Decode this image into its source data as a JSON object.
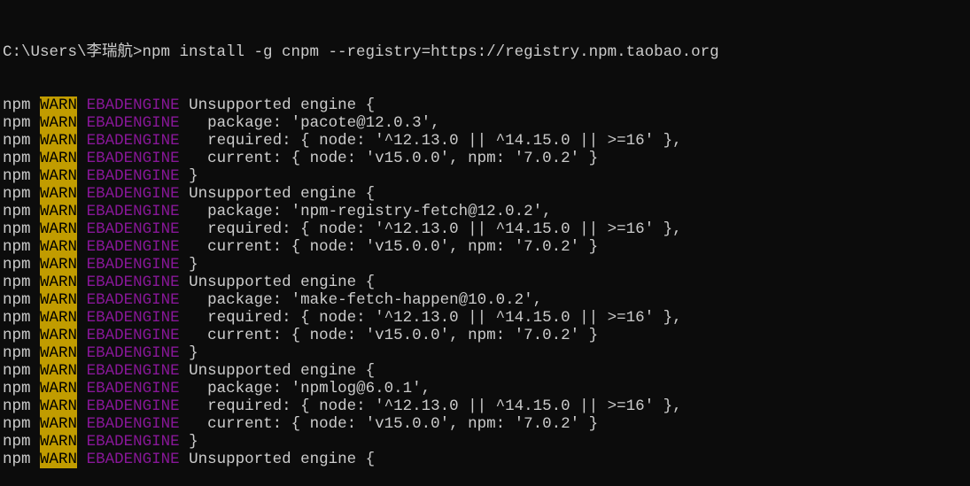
{
  "terminal": {
    "colors": {
      "background": "#0c0c0c",
      "foreground": "#cccccc",
      "warn_background": "#c19c00",
      "error_code": "#881798"
    },
    "prompt_line": "C:\\Users\\李瑞航>npm install -g cnpm --registry=https://registry.npm.taobao.org",
    "lines": [
      {
        "npm": "npm",
        "warn": "WARN",
        "code": "EBADENGINE",
        "message": " Unsupported engine {"
      },
      {
        "npm": "npm",
        "warn": "WARN",
        "code": "EBADENGINE",
        "message": "   package: 'pacote@12.0.3',"
      },
      {
        "npm": "npm",
        "warn": "WARN",
        "code": "EBADENGINE",
        "message": "   required: { node: '^12.13.0 || ^14.15.0 || >=16' },"
      },
      {
        "npm": "npm",
        "warn": "WARN",
        "code": "EBADENGINE",
        "message": "   current: { node: 'v15.0.0', npm: '7.0.2' }"
      },
      {
        "npm": "npm",
        "warn": "WARN",
        "code": "EBADENGINE",
        "message": " }"
      },
      {
        "npm": "npm",
        "warn": "WARN",
        "code": "EBADENGINE",
        "message": " Unsupported engine {"
      },
      {
        "npm": "npm",
        "warn": "WARN",
        "code": "EBADENGINE",
        "message": "   package: 'npm-registry-fetch@12.0.2',"
      },
      {
        "npm": "npm",
        "warn": "WARN",
        "code": "EBADENGINE",
        "message": "   required: { node: '^12.13.0 || ^14.15.0 || >=16' },"
      },
      {
        "npm": "npm",
        "warn": "WARN",
        "code": "EBADENGINE",
        "message": "   current: { node: 'v15.0.0', npm: '7.0.2' }"
      },
      {
        "npm": "npm",
        "warn": "WARN",
        "code": "EBADENGINE",
        "message": " }"
      },
      {
        "npm": "npm",
        "warn": "WARN",
        "code": "EBADENGINE",
        "message": " Unsupported engine {"
      },
      {
        "npm": "npm",
        "warn": "WARN",
        "code": "EBADENGINE",
        "message": "   package: 'make-fetch-happen@10.0.2',"
      },
      {
        "npm": "npm",
        "warn": "WARN",
        "code": "EBADENGINE",
        "message": "   required: { node: '^12.13.0 || ^14.15.0 || >=16' },"
      },
      {
        "npm": "npm",
        "warn": "WARN",
        "code": "EBADENGINE",
        "message": "   current: { node: 'v15.0.0', npm: '7.0.2' }"
      },
      {
        "npm": "npm",
        "warn": "WARN",
        "code": "EBADENGINE",
        "message": " }"
      },
      {
        "npm": "npm",
        "warn": "WARN",
        "code": "EBADENGINE",
        "message": " Unsupported engine {"
      },
      {
        "npm": "npm",
        "warn": "WARN",
        "code": "EBADENGINE",
        "message": "   package: 'npmlog@6.0.1',"
      },
      {
        "npm": "npm",
        "warn": "WARN",
        "code": "EBADENGINE",
        "message": "   required: { node: '^12.13.0 || ^14.15.0 || >=16' },"
      },
      {
        "npm": "npm",
        "warn": "WARN",
        "code": "EBADENGINE",
        "message": "   current: { node: 'v15.0.0', npm: '7.0.2' }"
      },
      {
        "npm": "npm",
        "warn": "WARN",
        "code": "EBADENGINE",
        "message": " }"
      },
      {
        "npm": "npm",
        "warn": "WARN",
        "code": "EBADENGINE",
        "message": " Unsupported engine {"
      }
    ]
  }
}
